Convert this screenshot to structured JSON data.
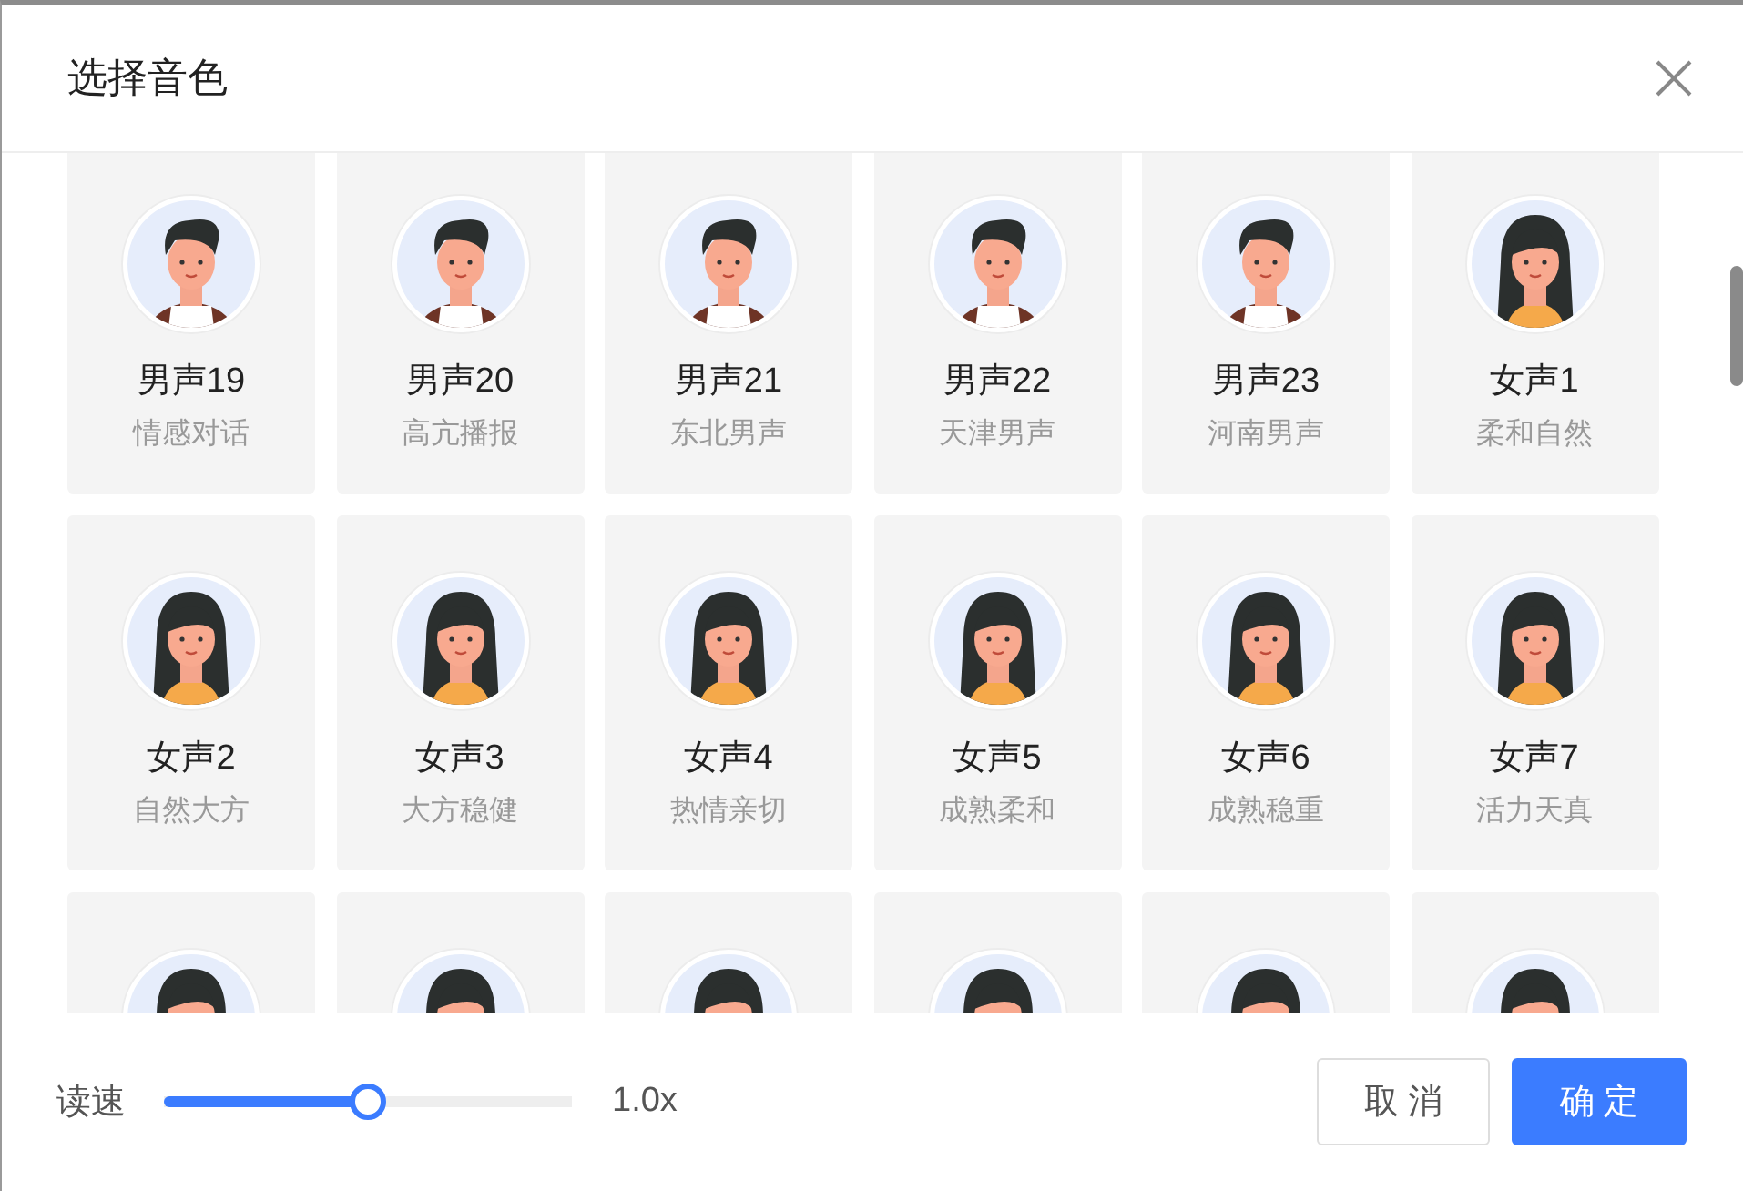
{
  "dialog": {
    "title": "选择音色"
  },
  "voices": [
    {
      "kind": "male",
      "name": "男声19",
      "style": "情感对话"
    },
    {
      "kind": "male",
      "name": "男声20",
      "style": "高亢播报"
    },
    {
      "kind": "male",
      "name": "男声21",
      "style": "东北男声"
    },
    {
      "kind": "male",
      "name": "男声22",
      "style": "天津男声"
    },
    {
      "kind": "male",
      "name": "男声23",
      "style": "河南男声"
    },
    {
      "kind": "female",
      "name": "女声1",
      "style": "柔和自然"
    },
    {
      "kind": "female",
      "name": "女声2",
      "style": "自然大方"
    },
    {
      "kind": "female",
      "name": "女声3",
      "style": "大方稳健"
    },
    {
      "kind": "female",
      "name": "女声4",
      "style": "热情亲切"
    },
    {
      "kind": "female",
      "name": "女声5",
      "style": "成熟柔和"
    },
    {
      "kind": "female",
      "name": "女声6",
      "style": "成熟稳重"
    },
    {
      "kind": "female",
      "name": "女声7",
      "style": "活力天真"
    },
    {
      "kind": "female"
    },
    {
      "kind": "female"
    },
    {
      "kind": "female"
    },
    {
      "kind": "female"
    },
    {
      "kind": "female"
    },
    {
      "kind": "female"
    }
  ],
  "speed": {
    "label": "读速",
    "level": 0.5,
    "reading": "1.0x"
  },
  "buttons": [
    {
      "label": "取 消",
      "kind": "secondary"
    },
    {
      "label": "确 定",
      "kind": "primary"
    }
  ]
}
